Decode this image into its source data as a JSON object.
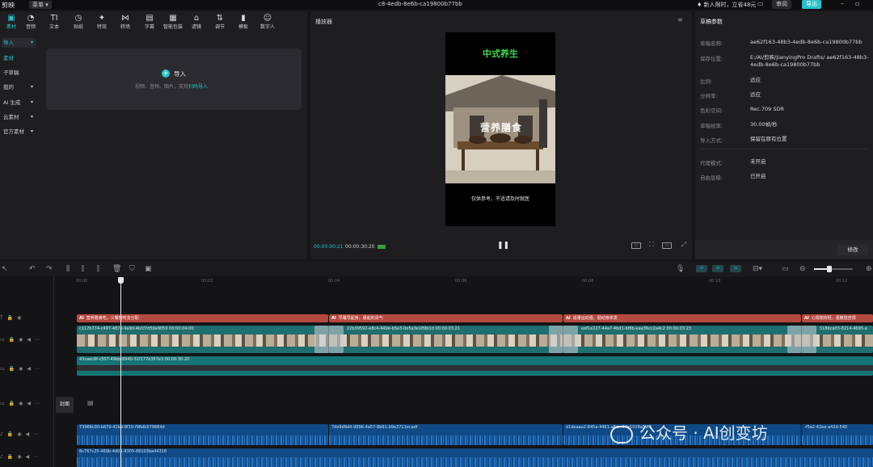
{
  "titlebar": {
    "app": "剪映",
    "menu": "菜单",
    "document": "c8-4edb-8e6b-ca19800b77bb",
    "vip": "新人限时，立省48元",
    "review": "审阅",
    "export": "导出"
  },
  "toolbar": {
    "items": [
      {
        "label": "素材",
        "icon": "media-icon"
      },
      {
        "label": "音频",
        "icon": "audio-icon"
      },
      {
        "label": "文本",
        "icon": "text-icon"
      },
      {
        "label": "贴纸",
        "icon": "sticker-icon"
      },
      {
        "label": "特效",
        "icon": "effects-icon"
      },
      {
        "label": "转场",
        "icon": "transition-icon"
      },
      {
        "label": "字幕",
        "icon": "subtitle-icon"
      },
      {
        "label": "智能包装",
        "icon": "smart-pack-icon"
      },
      {
        "label": "滤镜",
        "icon": "filter-icon"
      },
      {
        "label": "调节",
        "icon": "adjust-icon"
      },
      {
        "label": "模板",
        "icon": "template-icon"
      },
      {
        "label": "数字人",
        "icon": "avatar-icon"
      }
    ]
  },
  "sidebar": {
    "items": [
      {
        "label": "导入"
      },
      {
        "label": "素材"
      },
      {
        "label": "子草稿"
      },
      {
        "label": "我的"
      },
      {
        "label": "AI 生成"
      },
      {
        "label": "云素材"
      },
      {
        "label": "官方素材"
      }
    ]
  },
  "import_box": {
    "label": "导入",
    "hint": "视频、音频、图片，支持",
    "hint_link": "扫码导入"
  },
  "player": {
    "title": "播放器",
    "video_title": "中式养生",
    "video_subtitle": "仅供参考，不适请及时就医",
    "overlay_text": "营养膳食",
    "time_current": "00:00:00:21",
    "time_total": "00:00:30:20",
    "controls": [
      "full-screen-ratio",
      "crop",
      "ratio",
      "fullscreen"
    ]
  },
  "props": {
    "title": "草稿参数",
    "rows": [
      {
        "k": "草稿名称:",
        "v": "ae62f163-48b3-4edb-8e6b-ca19800b77bb"
      },
      {
        "k": "保存位置:",
        "v": "E:/AI/剪映/JianyingPro Drafts/ ae62f163-48b3-4edb-8e6b-ca19800b77bb"
      },
      {
        "k": "比例:",
        "v": "适应"
      },
      {
        "k": "分辨率:",
        "v": "适应"
      },
      {
        "k": "色彩空间:",
        "v": "Rec.709 SDR"
      },
      {
        "k": "草稿帧率:",
        "v": "30.00帧/秒"
      },
      {
        "k": "导入方式:",
        "v": "保留在原有位置"
      },
      {
        "k": "代理模式:",
        "v": "未开启"
      },
      {
        "k": "自由层级:",
        "v": "已开启"
      }
    ],
    "modify": "修改"
  },
  "timeline": {
    "ruler": [
      "00:00",
      "00:02",
      "00:04",
      "00:06",
      "00:08",
      "00:10",
      "00:12"
    ],
    "text_clips": [
      {
        "ai": "AI",
        "label": "营养膳食吃，三餐按时去分配"
      },
      {
        "ai": "AI",
        "label": "早睡早起身，晨起的清气"
      },
      {
        "ai": "AI",
        "label": "适量运动强，勤动身体发"
      },
      {
        "ai": "AI",
        "label": "心情愉快轻，驱散愁苦烦"
      }
    ],
    "video_clips": [
      {
        "label": "c117b774-c497-487e-9a9d-4b1f7d5be9050  00:00:04:00"
      },
      {
        "label": "22b39592-e8c4-440e-b5e3-0e5a3e189b1d  00:00:03:21"
      },
      {
        "label": "eef1e227-44a7-4bd1-bf8b-eaa36cc2a4c2  00:00:03:23"
      },
      {
        "label": "518bca03-8214-4695-a"
      }
    ],
    "sub_clip": "43caec6f-c507-49bb-8940-31f177e357e3  00:00:30:20",
    "cover_label": "封面",
    "audio_clips_1": [
      {
        "label": "73966c00-b670-41b9-8f10-f96db579684d"
      },
      {
        "label": "7de9d9d4-9096-4a57-8b91-b9e3711ecadf"
      },
      {
        "label": "d1deaaa2-845a-4461-a6ec-44e1018a59f6"
      },
      {
        "label": "-f5a2-42ee-a42d-540"
      }
    ],
    "audio_clip_2": "8c767c25-469b-4d05-9305-68103ba44318"
  },
  "watermark": "公众号 · AI创变坊",
  "colors": {
    "accent": "#27c2c8",
    "text_clip": "#b5483f",
    "video_clip": "#1f6e70",
    "audio_clip": "#0f4a86"
  }
}
